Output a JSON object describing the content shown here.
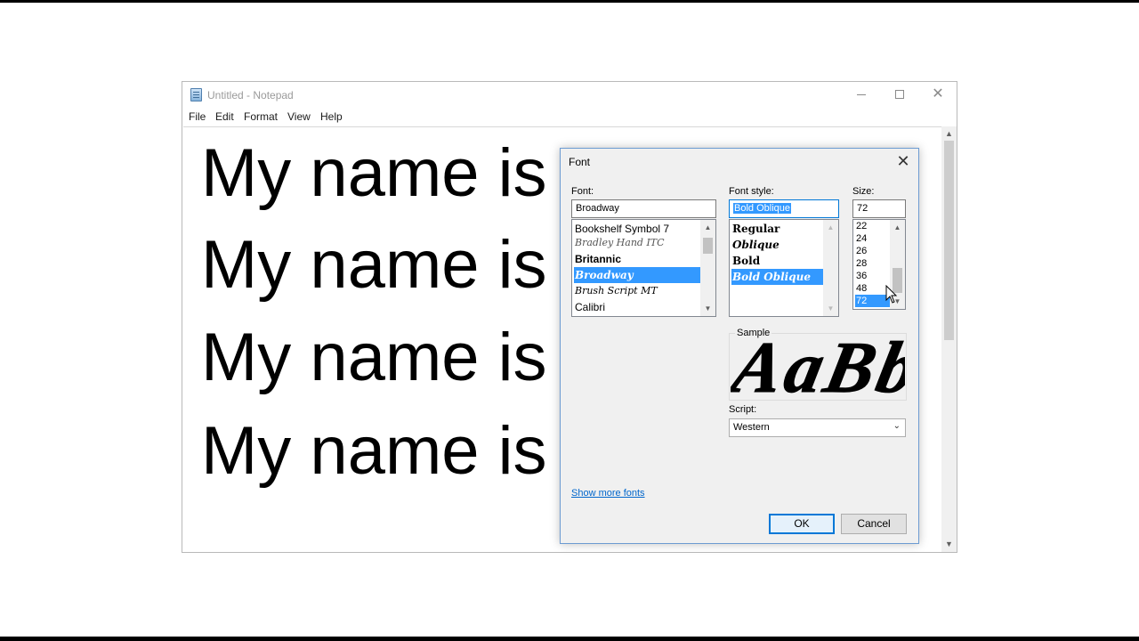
{
  "notepad": {
    "title": "Untitled - Notepad",
    "menu": [
      "File",
      "Edit",
      "Format",
      "View",
      "Help"
    ],
    "lines": [
      "My name is",
      "My name is",
      "My name is",
      "My name is"
    ]
  },
  "font_dialog": {
    "title": "Font",
    "font_label": "Font:",
    "font_value": "Broadway",
    "font_list": [
      "Bookshelf Symbol 7",
      "Bradley Hand ITC",
      "Britannic",
      "Broadway",
      "Brush Script MT",
      "Calibri"
    ],
    "font_selected": "Broadway",
    "style_label": "Font style:",
    "style_value": "Bold Oblique",
    "style_list": [
      "Regular",
      "Oblique",
      "Bold",
      "Bold Oblique"
    ],
    "style_selected": "Bold Oblique",
    "size_label": "Size:",
    "size_value": "72",
    "size_list": [
      "22",
      "24",
      "26",
      "28",
      "36",
      "48",
      "72"
    ],
    "size_selected": "72",
    "sample_label": "Sample",
    "sample_text": "AaBb",
    "script_label": "Script:",
    "script_value": "Western",
    "show_more_fonts": "Show more fonts",
    "ok_label": "OK",
    "cancel_label": "Cancel"
  },
  "colors": {
    "selection": "#3399ff",
    "link": "#0066cc",
    "dialog_border": "#6c9bd2"
  }
}
